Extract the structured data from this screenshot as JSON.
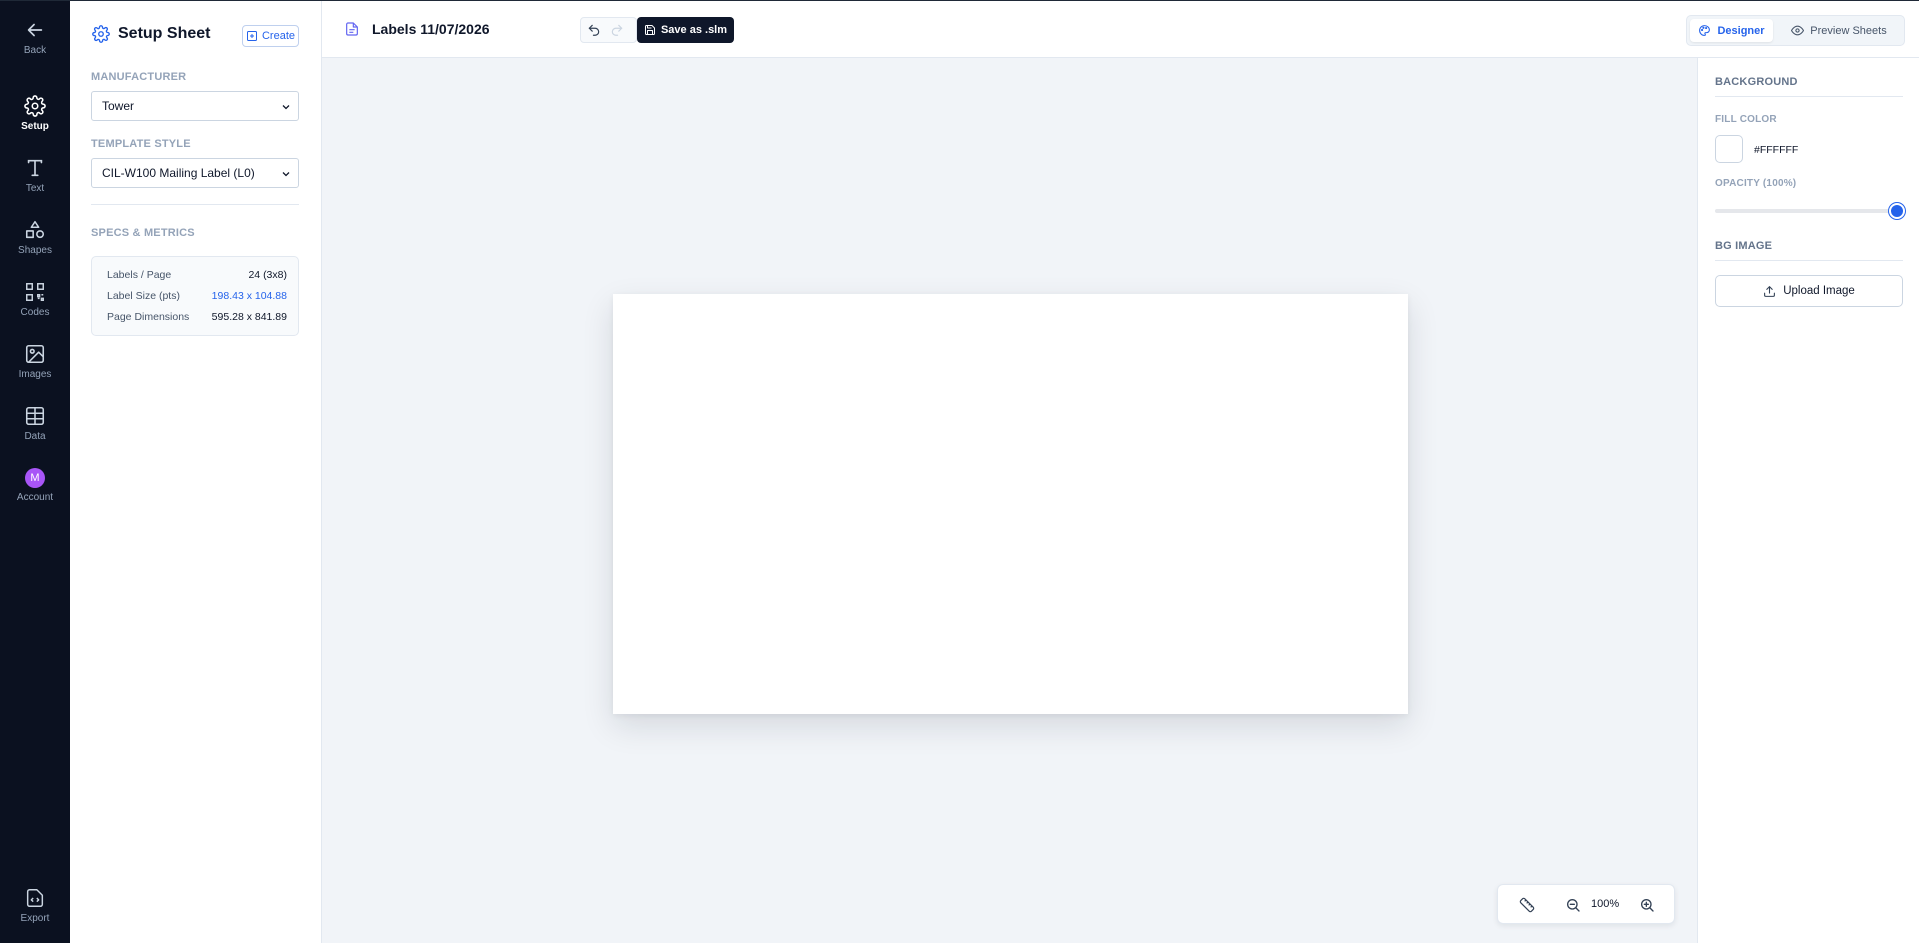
{
  "rail": {
    "back": "Back",
    "setup": "Setup",
    "text": "Text",
    "shapes": "Shapes",
    "codes": "Codes",
    "images": "Images",
    "data": "Data",
    "account": "Account",
    "account_initial": "M",
    "export": "Export",
    "avatar_color": "#a855f7"
  },
  "setup_panel": {
    "title": "Setup Sheet",
    "create_label": "Create",
    "manufacturer_label": "MANUFACTURER",
    "manufacturer_value": "Tower",
    "template_label": "TEMPLATE STYLE",
    "template_value": "CIL-W100 Mailing Label (L0)",
    "specs_label": "SPECS & METRICS",
    "specs": [
      {
        "key": "Labels / Page",
        "value": "24 (3x8)"
      },
      {
        "key": "Label Size (pts)",
        "value": "198.43 x 104.88"
      },
      {
        "key": "Page Dimensions",
        "value": "595.28 x 841.89"
      }
    ]
  },
  "toolbar": {
    "doc_title": "Labels 11/07/2026",
    "save_label": "Save as .slm",
    "designer_label": "Designer",
    "preview_label": "Preview Sheets"
  },
  "canvas": {
    "zoom": "100%"
  },
  "properties": {
    "background_head": "BACKGROUND",
    "fill_color_label": "FILL COLOR",
    "fill_color_value": "#FFFFFF",
    "opacity_label": "OPACITY (100%)",
    "opacity_fraction": 1.0,
    "bg_image_head": "BG IMAGE",
    "upload_label": "Upload Image"
  },
  "colors": {
    "accent": "#2563eb",
    "rail_bg": "#0b1120",
    "primary_button": "#0f172a"
  }
}
